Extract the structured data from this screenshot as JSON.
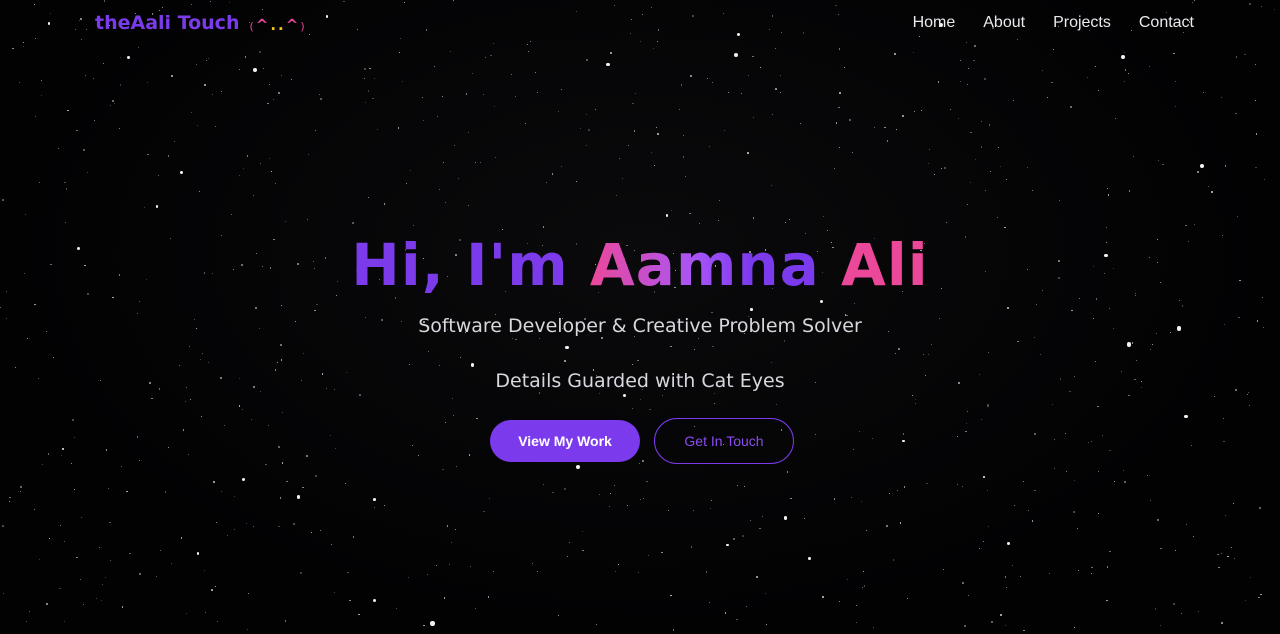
{
  "nav": {
    "logo_text": "theAali Touch",
    "logo_face": {
      "paren_left": "(",
      "ear_left": "^",
      "eye_left": ".",
      "eye_right": ".",
      "ear_right": "^",
      "paren_right": ")"
    },
    "links": [
      "Home",
      "About",
      "Projects",
      "Contact"
    ]
  },
  "hero": {
    "greeting": "Hi, I'm",
    "name_first": "Aamna",
    "name_last": "Ali",
    "subtitle": "Software Developer & Creative Problem Solver",
    "tagline": "Details Guarded with Cat Eyes",
    "primary_button": "View My Work",
    "secondary_button": "Get In Touch"
  },
  "colors": {
    "background": "#020203",
    "accent_purple": "#7c3aed",
    "accent_pink": "#ec4899",
    "eye_yellow": "#f2c21a",
    "text_light": "#d7d7de"
  }
}
